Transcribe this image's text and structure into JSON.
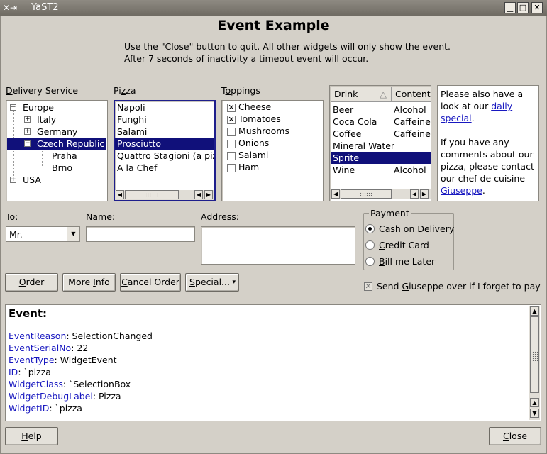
{
  "window": {
    "title": "YaST2",
    "minimize": "▁",
    "maximize": "□",
    "close": "✕"
  },
  "heading": "Event Example",
  "description": [
    "Use the \"Close\" button to quit. All other widgets will only show the event.",
    "After 7 seconds of inactivity a timeout event will occur."
  ],
  "delivery": {
    "label_u": "D",
    "label_rest": "elivery Service",
    "tree": [
      {
        "label": "Europe",
        "expander": "−",
        "level": 0
      },
      {
        "label": "Italy",
        "expander": "+",
        "level": 1
      },
      {
        "label": "Germany",
        "expander": "+",
        "level": 1
      },
      {
        "label": "Czech Republic",
        "expander": "−",
        "level": 1,
        "selected": true
      },
      {
        "label": "Praha",
        "level": 2
      },
      {
        "label": "Brno",
        "level": 2
      },
      {
        "label": "USA",
        "expander": "+",
        "level": 0
      }
    ]
  },
  "pizza": {
    "label_pre": "Pi",
    "label_u": "z",
    "label_post": "za",
    "items": [
      "Napoli",
      "Funghi",
      "Salami",
      "Prosciutto",
      "Quattro Stagioni (a pizza",
      "A la Chef"
    ],
    "selected": "Prosciutto"
  },
  "toppings": {
    "label_pre": "T",
    "label_u": "o",
    "label_post": "ppings",
    "items": [
      {
        "label": "Cheese",
        "checked": true
      },
      {
        "label": "Tomatoes",
        "checked": true
      },
      {
        "label": "Mushrooms",
        "checked": false
      },
      {
        "label": "Onions",
        "checked": false
      },
      {
        "label": "Salami",
        "checked": false
      },
      {
        "label": "Ham",
        "checked": false
      }
    ]
  },
  "drinks": {
    "columns": [
      "Drink",
      "Contents"
    ],
    "sort_indicator": "△",
    "rows": [
      [
        "Beer",
        "Alcohol"
      ],
      [
        "Coca Cola",
        "Caffeine"
      ],
      [
        "Coffee",
        "Caffeine"
      ],
      [
        "Mineral Water",
        ""
      ],
      [
        "Sprite",
        ""
      ],
      [
        "Wine",
        "Alcohol"
      ]
    ],
    "selected": "Sprite"
  },
  "info": {
    "p1_pre": "Please also have a look at our ",
    "p1_link": "daily special",
    "p1_post": ".",
    "p2_pre": "If you have any comments about our pizza, please contact our chef de cuisine ",
    "p2_link": "Giuseppe",
    "p2_post": "."
  },
  "form": {
    "to_label": "T",
    "to_label_rest": "o:",
    "to_value": "Mr.",
    "name_label": "N",
    "name_label_rest": "ame:",
    "address_label": "A",
    "address_label_rest": "ddress:",
    "name_value": "",
    "address_value": ""
  },
  "payment": {
    "title": "Payment",
    "options": [
      {
        "pre": "Cash on ",
        "u": "D",
        "post": "elivery",
        "selected": true
      },
      {
        "pre": "",
        "u": "C",
        "post": "redit Card",
        "selected": false
      },
      {
        "pre": "",
        "u": "B",
        "post": "ill me Later",
        "selected": false
      }
    ]
  },
  "buttons": {
    "order_u": "O",
    "order_rest": "rder",
    "more_pre": "More ",
    "more_u": "I",
    "more_post": "nfo",
    "cancel_u": "C",
    "cancel_rest": "ancel Order",
    "special_u": "S",
    "special_rest": "pecial...",
    "special_arrow": "▾",
    "help_u": "H",
    "help_rest": "elp",
    "close_u": "C",
    "close_rest": "lose"
  },
  "send_checkbox": {
    "pre": "Send ",
    "u": "G",
    "post": "iuseppe over if I forget to pay",
    "checked": true
  },
  "event": {
    "title": "Event:",
    "fields": [
      {
        "key": "EventReason",
        "value": ": SelectionChanged"
      },
      {
        "key": "EventSerialNo",
        "value": ": 22"
      },
      {
        "key": "EventType",
        "value": ": WidgetEvent"
      },
      {
        "key": "ID",
        "value": ": `pizza"
      },
      {
        "key": "WidgetClass",
        "value": ": `SelectionBox"
      },
      {
        "key": "WidgetDebugLabel",
        "value": ": Pizza"
      },
      {
        "key": "WidgetID",
        "value": ": `pizza"
      }
    ]
  },
  "colors": {
    "selection": "#10107a",
    "link": "#1818c0",
    "background": "#d4d0c8"
  }
}
